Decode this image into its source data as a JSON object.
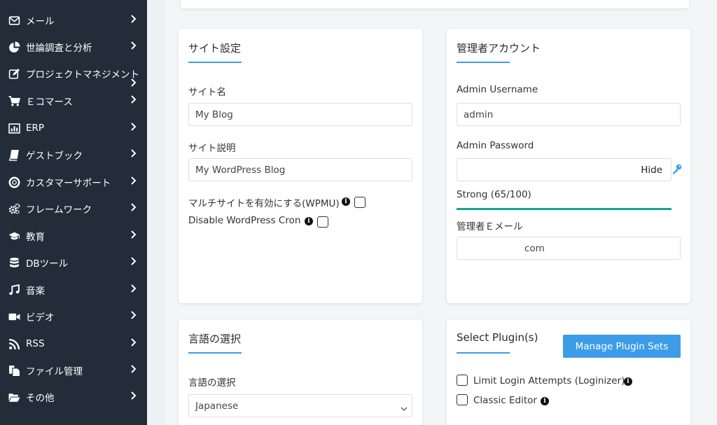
{
  "sidebar": {
    "items": [
      {
        "label": "メール",
        "icon": "mail-icon"
      },
      {
        "label": "世論調査と分析",
        "icon": "pie-chart-icon"
      },
      {
        "label": "プロジェクトマネジメント",
        "icon": "edit-icon"
      },
      {
        "label": "Ｅコマース",
        "icon": "cart-icon"
      },
      {
        "label": "ERP",
        "icon": "bar-chart-icon"
      },
      {
        "label": "ゲストブック",
        "icon": "book-icon"
      },
      {
        "label": "カスタマーサポート",
        "icon": "lifebuoy-icon"
      },
      {
        "label": "フレームワーク",
        "icon": "cogs-icon"
      },
      {
        "label": "教育",
        "icon": "graduation-cap-icon"
      },
      {
        "label": "DBツール",
        "icon": "database-icon"
      },
      {
        "label": "音楽",
        "icon": "music-icon"
      },
      {
        "label": "ビデオ",
        "icon": "video-icon"
      },
      {
        "label": "RSS",
        "icon": "rss-icon"
      },
      {
        "label": "ファイル管理",
        "icon": "files-icon"
      },
      {
        "label": "その他",
        "icon": "folder-open-icon"
      }
    ]
  },
  "site_settings": {
    "title": "サイト設定",
    "site_name_label": "サイト名",
    "site_name_value": "My Blog",
    "site_desc_label": "サイト説明",
    "site_desc_value": "My WordPress Blog",
    "multisite_label": "マルチサイトを有効にする(WPMU)",
    "disable_cron_label": "Disable WordPress Cron"
  },
  "admin_account": {
    "title": "管理者アカウント",
    "username_label": "Admin Username",
    "username_value": "admin",
    "password_label": "Admin Password",
    "password_value": "",
    "hide_label": "Hide",
    "strength_text": "Strong (65/100)",
    "strength_fraction": 0.65,
    "email_label": "管理者Ｅメール",
    "email_value": "com"
  },
  "language": {
    "title": "言語の選択",
    "select_label": "言語の選択",
    "selected": "Japanese"
  },
  "plugins": {
    "title": "Select Plugin(s)",
    "manage_button": "Manage Plugin Sets",
    "items": [
      "Limit Login Attempts (Loginizer)",
      "Classic Editor"
    ]
  },
  "colors": {
    "sidebar_bg": "#222d39",
    "accent": "#3d9ce8",
    "strength": "#17a293"
  }
}
